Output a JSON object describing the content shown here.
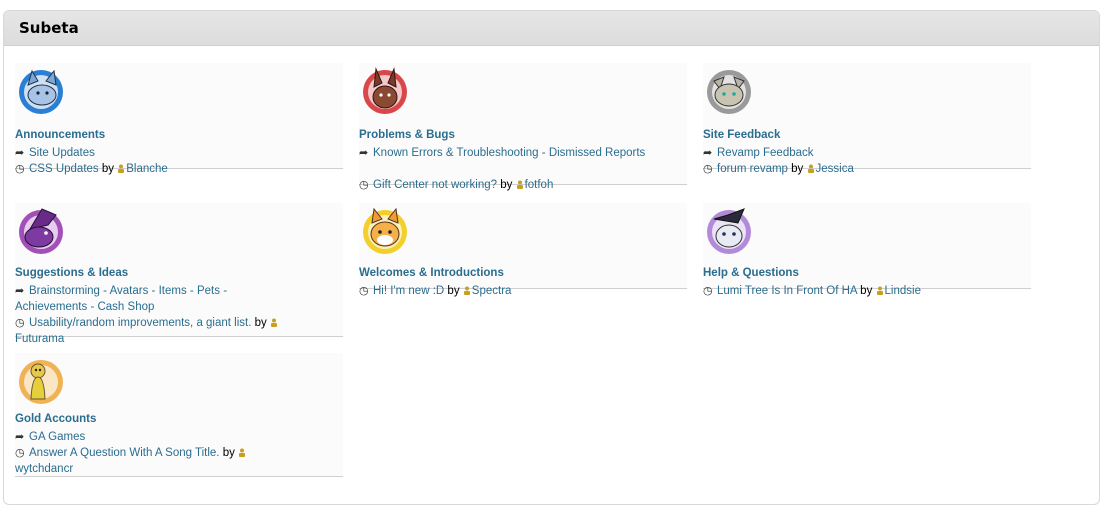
{
  "header": {
    "title": "Subeta"
  },
  "forums": [
    {
      "name": "Announcements",
      "avatar_color": "#2a7fd4",
      "subforums": [
        "Site Updates"
      ],
      "latest": {
        "title": "CSS Updates",
        "by": "by",
        "user": "Blanche"
      }
    },
    {
      "name": "Problems & Bugs",
      "avatar_color": "#d9474a",
      "subforums": [
        "Known Errors & Troubleshooting",
        "Dismissed Reports"
      ],
      "latest": {
        "title": "Gift Center not working?",
        "by": "by",
        "user": "fotfoh"
      }
    },
    {
      "name": "Site Feedback",
      "avatar_color": "#9a9a9a",
      "subforums": [
        "Revamp Feedback"
      ],
      "latest": {
        "title": "forum revamp",
        "by": "by",
        "user": "Jessica"
      }
    },
    {
      "name": "Suggestions & Ideas",
      "avatar_color": "#a24fb8",
      "subforums": [
        "Brainstorming",
        "Avatars",
        "Items",
        "Pets",
        "Achievements",
        "Cash Shop"
      ],
      "latest": {
        "title": "Usability/random improvements, a giant list.",
        "by": "by",
        "user": "Futurama"
      }
    },
    {
      "name": "Welcomes & Introductions",
      "avatar_color": "#f2cf2a",
      "subforums": [],
      "latest": {
        "title": "Hi! I'm new :D",
        "by": "by",
        "user": "Spectra"
      }
    },
    {
      "name": "Help & Questions",
      "avatar_color": "#b18ad9",
      "subforums": [],
      "latest": {
        "title": "Lumi Tree Is In Front Of HA",
        "by": "by",
        "user": "Lindsie"
      }
    },
    {
      "name": "Gold Accounts",
      "avatar_color": "#f0b255",
      "subforums": [
        "GA Games"
      ],
      "latest": {
        "title": "Answer A Question With A Song Title.",
        "by": "by",
        "user": "wytchdancr"
      }
    }
  ],
  "icons": {
    "subforum": "arrow-turn-icon",
    "latest": "clock-icon",
    "user": "user-icon"
  },
  "colors": {
    "link": "#2a6d8f",
    "header_bg": "#dddddd"
  }
}
